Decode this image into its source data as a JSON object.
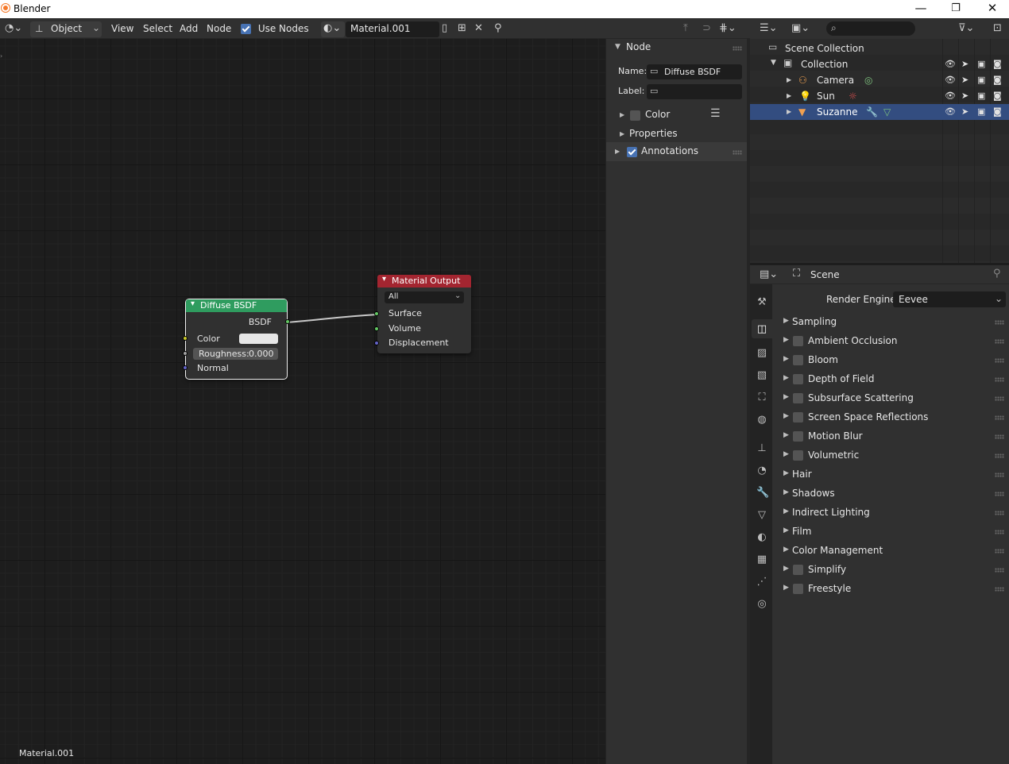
{
  "window": {
    "title": "Blender",
    "minimize": "—",
    "maximize": "❐",
    "close": "✕"
  },
  "header": {
    "mode": "Object",
    "menus": [
      "View",
      "Select",
      "Add",
      "Node"
    ],
    "use_nodes_label": "Use Nodes",
    "material_name": "Material.001"
  },
  "sidebar": {
    "panel_title": "Node",
    "name_label": "Name:",
    "name_value": "Diffuse BSDF",
    "label_label": "Label:",
    "label_value": "",
    "color_label": "Color",
    "properties_label": "Properties",
    "annotations_label": "Annotations"
  },
  "nodes": {
    "diffuse": {
      "title": "Diffuse BSDF",
      "output": "BSDF",
      "color_label": "Color",
      "roughness": "Roughness:",
      "roughness_value": "0.000",
      "normal": "Normal",
      "color": "#e6e6e6"
    },
    "output": {
      "title": "Material Output",
      "target": "All",
      "surface": "Surface",
      "volume": "Volume",
      "displacement": "Displacement"
    }
  },
  "footer": {
    "material": "Material.001"
  },
  "outliner": {
    "rows": [
      {
        "label": "Scene Collection"
      },
      {
        "label": "Collection"
      },
      {
        "label": "Camera"
      },
      {
        "label": "Sun"
      },
      {
        "label": "Suzanne"
      }
    ]
  },
  "properties": {
    "context": "Scene",
    "render_engine_label": "Render Engine",
    "render_engine": "Eevee",
    "panels": [
      {
        "label": "Sampling",
        "check": false
      },
      {
        "label": "Ambient Occlusion",
        "check": true
      },
      {
        "label": "Bloom",
        "check": true
      },
      {
        "label": "Depth of Field",
        "check": true
      },
      {
        "label": "Subsurface Scattering",
        "check": true
      },
      {
        "label": "Screen Space Reflections",
        "check": true
      },
      {
        "label": "Motion Blur",
        "check": true
      },
      {
        "label": "Volumetric",
        "check": true
      },
      {
        "label": "Hair",
        "check": false
      },
      {
        "label": "Shadows",
        "check": false
      },
      {
        "label": "Indirect Lighting",
        "check": false
      },
      {
        "label": "Film",
        "check": false
      },
      {
        "label": "Color Management",
        "check": false
      },
      {
        "label": "Simplify",
        "check": true
      },
      {
        "label": "Freestyle",
        "check": true
      }
    ]
  },
  "colors": {
    "diffuse_header": "#2f9c5f",
    "output_header": "#a32530",
    "selected_row": "#334d80",
    "accent": "#4772b3"
  }
}
